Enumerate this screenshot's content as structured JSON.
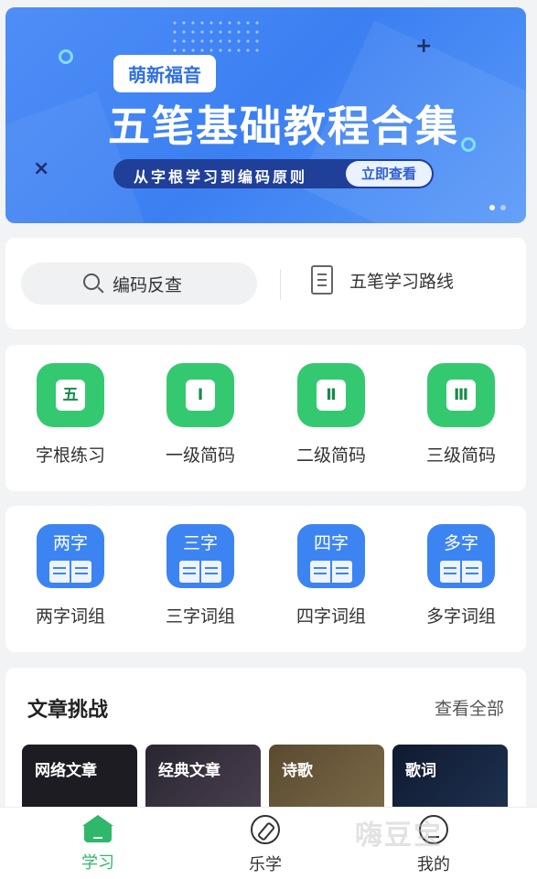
{
  "banner": {
    "pill": "萌新福音",
    "headline": "五笔基础教程合集",
    "subtitle": "从字根学习到编码原则",
    "cta": "立即查看"
  },
  "tools": {
    "search_label": "编码反查",
    "route_label": "五笔学习路线"
  },
  "level_grid": [
    {
      "glyph": "五",
      "label": "字根练习"
    },
    {
      "glyph": "Ⅰ",
      "label": "一级简码"
    },
    {
      "glyph": "Ⅱ",
      "label": "二级简码"
    },
    {
      "glyph": "Ⅲ",
      "label": "三级简码"
    }
  ],
  "phrase_grid": [
    {
      "glyph": "两字",
      "label": "两字词组"
    },
    {
      "glyph": "三字",
      "label": "三字词组"
    },
    {
      "glyph": "四字",
      "label": "四字词组"
    },
    {
      "glyph": "多字",
      "label": "多字词组"
    }
  ],
  "articles": {
    "title": "文章挑战",
    "more": "查看全部",
    "tiles": [
      {
        "label": "网络文章",
        "color": "#1c1c22"
      },
      {
        "label": "经典文章",
        "color": "#3a3440"
      },
      {
        "label": "诗歌",
        "color": "#6b5a3a"
      },
      {
        "label": "歌词",
        "color": "#16243c"
      }
    ]
  },
  "tabbar": {
    "items": [
      {
        "label": "学习",
        "icon": "home-icon",
        "active": true
      },
      {
        "label": "乐学",
        "icon": "compass-icon",
        "active": false
      },
      {
        "label": "我的",
        "icon": "profile-icon",
        "active": false
      }
    ]
  },
  "watermark": "嗨豆宝",
  "colors": {
    "brand_green": "#34c971",
    "tab_active": "#2fb76a",
    "icon_blue": "#3d84f3",
    "banner_blue": "#3b7ff2"
  }
}
